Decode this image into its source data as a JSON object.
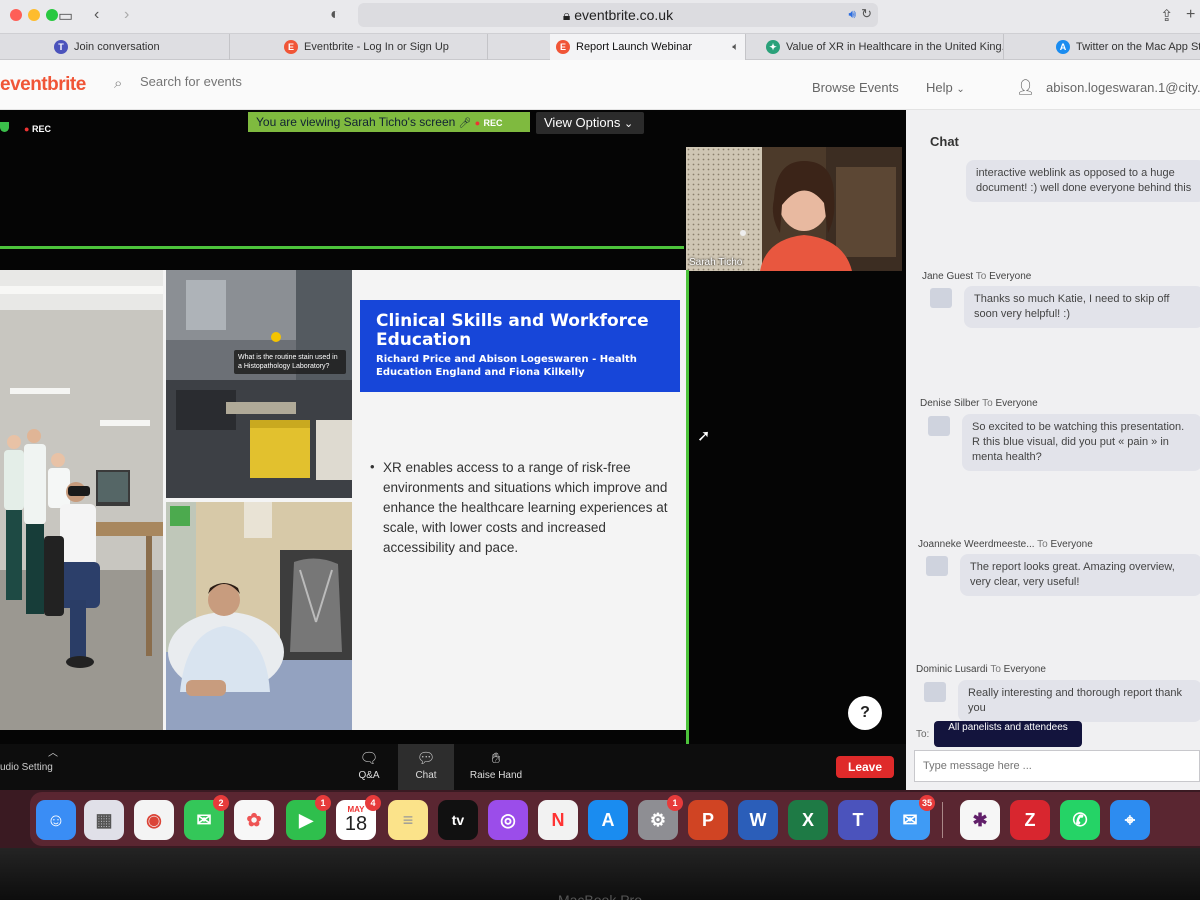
{
  "browser": {
    "url": "eventbrite.co.uk",
    "tabs": [
      {
        "label": "Join conversation",
        "icon": "teams-icon",
        "color": "#4b53bc",
        "active": false
      },
      {
        "label": "Eventbrite - Log In or Sign Up",
        "icon": "eventbrite-icon",
        "color": "#f05537",
        "active": false
      },
      {
        "label": "Report Launch Webinar",
        "icon": "eventbrite-icon",
        "color": "#f05537",
        "active": true
      },
      {
        "label": "Value of XR in Healthcare in the United King...",
        "icon": "xr-icon",
        "color": "#2aa17a",
        "active": false
      },
      {
        "label": "Twitter on the Mac App Store",
        "icon": "app-store-icon",
        "color": "#1a8cf0",
        "active": false
      }
    ]
  },
  "eventbrite": {
    "logo": "eventbrite",
    "search_placeholder": "Search for events",
    "browse_events": "Browse Events",
    "help": "Help",
    "user_email": "abison.logeswaran.1@city.ac..."
  },
  "zoom": {
    "rec": "REC",
    "banner_text": "You are viewing Sarah Ticho's screen",
    "banner_rec": "REC",
    "view_options": "View Options",
    "presenter_name": "Sarah Ticho",
    "audio_setting": "udio Setting",
    "buttons": {
      "qa": "Q&A",
      "chat": "Chat",
      "raise_hand": "Raise Hand",
      "leave": "Leave"
    }
  },
  "slide": {
    "title": "Clinical Skills and Workforce Education",
    "subtitle": "Richard Price and Abison Logeswaren - Health Education England and Fiona Kilkelly",
    "bullet": "XR enables access to a range of risk-free environments and situations which improve and enhance the healthcare learning experiences at scale, with lower costs and increased accessibility and pace.",
    "lab_caption": "What is the routine stain used in a Histopathology Laboratory?"
  },
  "chat": {
    "header": "Chat",
    "messages": [
      {
        "sender": "",
        "to": "",
        "text": "interactive weblink as opposed to a huge document! :) well done everyone behind this"
      },
      {
        "sender": "Jane Guest",
        "to": "Everyone",
        "text": "Thanks so much Katie, I need to skip off soon very helpful! :)"
      },
      {
        "sender": "Denise Silber",
        "to": "Everyone",
        "text": "So excited to be watching this presentation. R this blue visual, did you put « pain » in menta health?"
      },
      {
        "sender": "Joanneke Weerdmeeste...",
        "to": "Everyone",
        "text": "The report looks great. Amazing overview, very clear, very useful!"
      },
      {
        "sender": "Dominic Lusardi",
        "to": "Everyone",
        "text": "Really interesting and thorough report thank you"
      }
    ],
    "to_label": "To:",
    "to_value": "All panelists and attendees",
    "to_word": "To",
    "input_placeholder": "Type message here ..."
  },
  "dock": {
    "apps": [
      {
        "name": "finder-icon",
        "color": "#3a8df5",
        "glyph": "☺",
        "badge": ""
      },
      {
        "name": "launchpad-icon",
        "color": "#e0e0e8",
        "glyph": "▦",
        "badge": ""
      },
      {
        "name": "chrome-icon",
        "color": "#f4f4f4",
        "glyph": "◉",
        "badge": ""
      },
      {
        "name": "messages-icon",
        "color": "#34c759",
        "glyph": "💬",
        "badge": "2"
      },
      {
        "name": "photos-icon",
        "color": "#f7f7f7",
        "glyph": "✿",
        "badge": ""
      },
      {
        "name": "facetime-icon",
        "color": "#2fbf4d",
        "glyph": "▶",
        "badge": "1"
      },
      {
        "name": "calendar-icon",
        "color": "#ffffff",
        "glyph": "18",
        "badge": "4"
      },
      {
        "name": "notes-icon",
        "color": "#fbe38a",
        "glyph": "≡",
        "badge": ""
      },
      {
        "name": "apple-tv-icon",
        "color": "#111111",
        "glyph": "tv",
        "badge": ""
      },
      {
        "name": "podcasts-icon",
        "color": "#9b4dea",
        "glyph": "◎",
        "badge": ""
      },
      {
        "name": "news-icon",
        "color": "#f2f2f2",
        "glyph": "N",
        "badge": ""
      },
      {
        "name": "app-store-icon",
        "color": "#1a8cf0",
        "glyph": "A",
        "badge": ""
      },
      {
        "name": "system-preferences-icon",
        "color": "#8e8e93",
        "glyph": "⚙",
        "badge": "1"
      },
      {
        "name": "powerpoint-icon",
        "color": "#d04423",
        "glyph": "P",
        "badge": ""
      },
      {
        "name": "word-icon",
        "color": "#2b5eb9",
        "glyph": "W",
        "badge": ""
      },
      {
        "name": "excel-icon",
        "color": "#1e7a45",
        "glyph": "X",
        "badge": ""
      },
      {
        "name": "teams-icon",
        "color": "#4b53bc",
        "glyph": "T",
        "badge": ""
      },
      {
        "name": "mail-icon",
        "color": "#3f9bf5",
        "glyph": "✉",
        "badge": "35"
      },
      {
        "name": "slack-icon",
        "color": "#f6f6f6",
        "glyph": "✱",
        "badge": ""
      },
      {
        "name": "zotero-icon",
        "color": "#d8262f",
        "glyph": "Z",
        "badge": ""
      },
      {
        "name": "whatsapp-icon",
        "color": "#25d366",
        "glyph": "✆",
        "badge": ""
      },
      {
        "name": "safari-icon",
        "color": "#2d8cf0",
        "glyph": "⌖",
        "badge": ""
      }
    ],
    "calendar_month": "MAY"
  },
  "device_label": "MacBook Pro"
}
